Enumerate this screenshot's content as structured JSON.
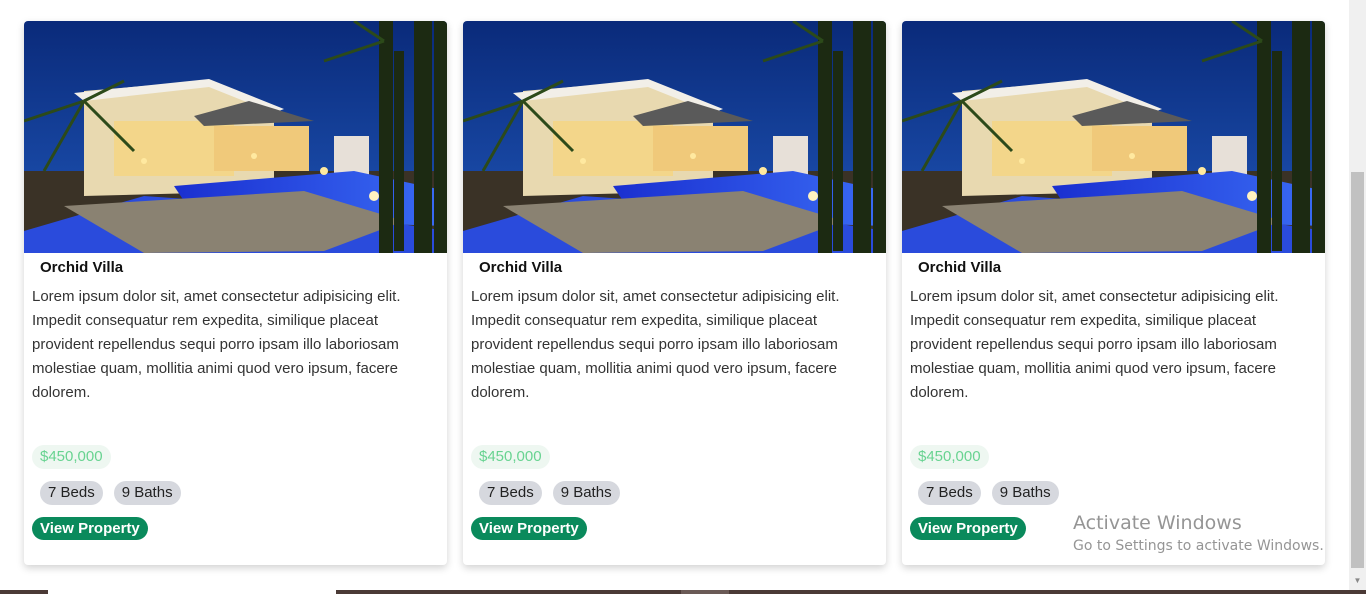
{
  "listings": [
    {
      "title": "Orchid Villa",
      "description": "Lorem ipsum dolor sit, amet consectetur adipisicing elit. Impedit consequatur rem expedita, similique placeat provident repellendus sequi porro ipsam illo laboriosam molestiae quam, mollitia animi quod vero ipsum, facere dolorem.",
      "price": "$450,000",
      "beds": "7 Beds",
      "baths": "9 Baths",
      "button_label": "View Property"
    },
    {
      "title": "Orchid Villa",
      "description": "Lorem ipsum dolor sit, amet consectetur adipisicing elit. Impedit consequatur rem expedita, similique placeat provident repellendus sequi porro ipsam illo laboriosam molestiae quam, mollitia animi quod vero ipsum, facere dolorem.",
      "price": "$450,000",
      "beds": "7 Beds",
      "baths": "9 Baths",
      "button_label": "View Property"
    },
    {
      "title": "Orchid Villa",
      "description": "Lorem ipsum dolor sit, amet consectetur adipisicing elit. Impedit consequatur rem expedita, similique placeat provident repellendus sequi porro ipsam illo laboriosam molestiae quam, mollitia animi quod vero ipsum, facere dolorem.",
      "price": "$450,000",
      "beds": "7 Beds",
      "baths": "9 Baths",
      "button_label": "View Property"
    }
  ],
  "watermark": {
    "title": "Activate Windows",
    "subtitle": "Go to Settings to activate Windows."
  },
  "colors": {
    "button": "#0a8a5c",
    "price_text": "#68d391",
    "tag_bg": "#d6d8de"
  }
}
